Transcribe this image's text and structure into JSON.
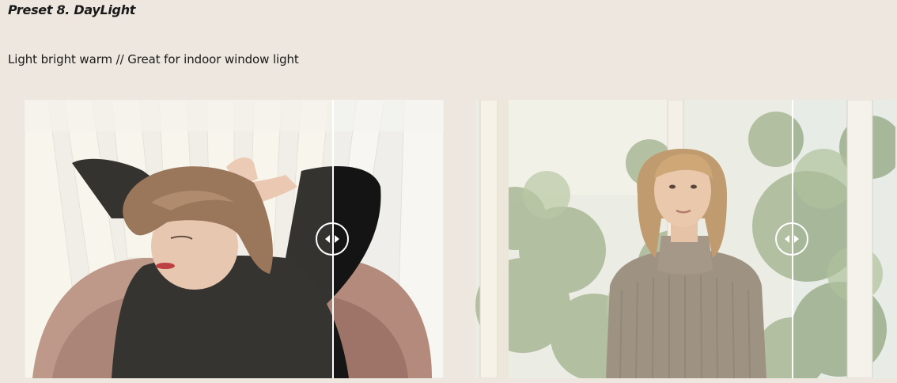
{
  "preset": {
    "title": "Preset 8. DayLight",
    "description": "Light bright warm // Great for indoor window light"
  },
  "comparisons": [
    {
      "name": "woman-on-pink-armchair",
      "slider_position": 0.735
    },
    {
      "name": "woman-in-turtleneck-by-window",
      "slider_position": 0.755
    }
  ],
  "icons": {
    "handle": "left-right-arrows-icon"
  },
  "colors": {
    "background": "#ede7df",
    "divider": "#ffffff"
  }
}
